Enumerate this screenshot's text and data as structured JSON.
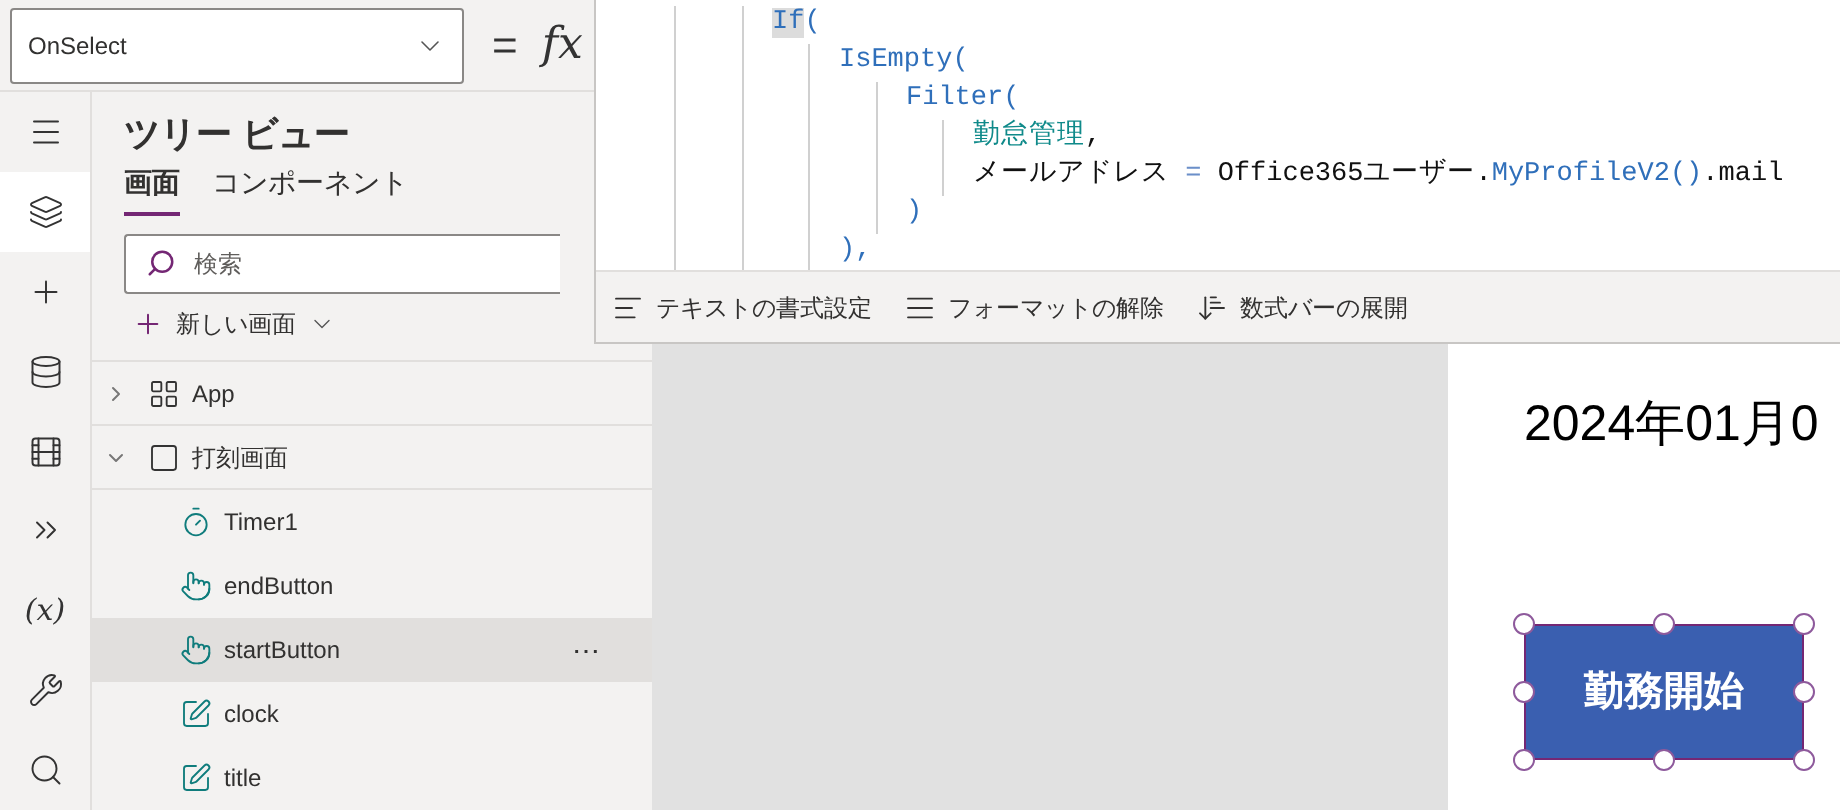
{
  "formula_bar": {
    "property": "OnSelect",
    "equals": "=",
    "fx": "fx"
  },
  "rail": [
    {
      "kind": "menu",
      "selected": false
    },
    {
      "kind": "layers",
      "selected": true
    },
    {
      "kind": "plus",
      "selected": false
    },
    {
      "kind": "database",
      "selected": false
    },
    {
      "kind": "media",
      "selected": false
    },
    {
      "kind": "automate",
      "selected": false
    },
    {
      "kind": "variables",
      "selected": false,
      "label": "(x)"
    },
    {
      "kind": "tools",
      "selected": false
    },
    {
      "kind": "search",
      "selected": false
    }
  ],
  "tree_view": {
    "title": "ツリー ビュー",
    "tabs": [
      {
        "label": "画面",
        "selected": true
      },
      {
        "label": "コンポーネント",
        "selected": false
      }
    ],
    "search": {
      "placeholder": "検索"
    },
    "new_screen": "新しい画面",
    "items": [
      {
        "kind": "app",
        "label": "App",
        "expanded": false,
        "selected": false
      },
      {
        "kind": "screen",
        "label": "打刻画面",
        "expanded": true,
        "selected": false,
        "children": [
          {
            "kind": "timer",
            "label": "Timer1",
            "selected": false
          },
          {
            "kind": "button",
            "label": "endButton",
            "selected": false
          },
          {
            "kind": "button",
            "label": "startButton",
            "selected": true,
            "more": "⋯"
          },
          {
            "kind": "label",
            "label": "clock",
            "selected": false
          },
          {
            "kind": "label",
            "label": "title",
            "selected": false
          }
        ]
      }
    ]
  },
  "formula_editor": {
    "code": [
      {
        "tokens": [
          {
            "text": "If",
            "kind": "match"
          },
          {
            "text": "(",
            "kind": "function"
          }
        ],
        "children": [
          {
            "tokens": [
              {
                "text": "IsEmpty(",
                "kind": "function"
              }
            ],
            "children": [
              {
                "tokens": [
                  {
                    "text": "Filter(",
                    "kind": "function"
                  }
                ],
                "children": [
                  {
                    "tokens": [
                      {
                        "text": "勤怠管理",
                        "kind": "table"
                      },
                      {
                        "text": ",",
                        "kind": "plain"
                      }
                    ]
                  },
                  {
                    "tokens": [
                      {
                        "text": "メールアドレス ",
                        "kind": "plain"
                      },
                      {
                        "text": "=",
                        "kind": "operator"
                      },
                      {
                        "text": " Office365ユーザー.",
                        "kind": "plain"
                      },
                      {
                        "text": "MyProfileV2()",
                        "kind": "function"
                      },
                      {
                        "text": ".mail",
                        "kind": "plain"
                      }
                    ]
                  }
                ]
              },
              {
                "tokens": [
                  {
                    "text": ")",
                    "kind": "function"
                  }
                ]
              }
            ]
          },
          {
            "tokens": [
              {
                "text": "),",
                "kind": "function"
              }
            ]
          }
        ]
      }
    ],
    "toolbar": [
      {
        "kind": "format",
        "label": "テキストの書式設定"
      },
      {
        "kind": "unformat",
        "label": "フォーマットの解除"
      },
      {
        "kind": "expand",
        "label": "数式バーの展開"
      }
    ]
  },
  "canvas": {
    "date": "2024年01月0",
    "button": {
      "label": "勤務開始",
      "selected": true
    }
  }
}
